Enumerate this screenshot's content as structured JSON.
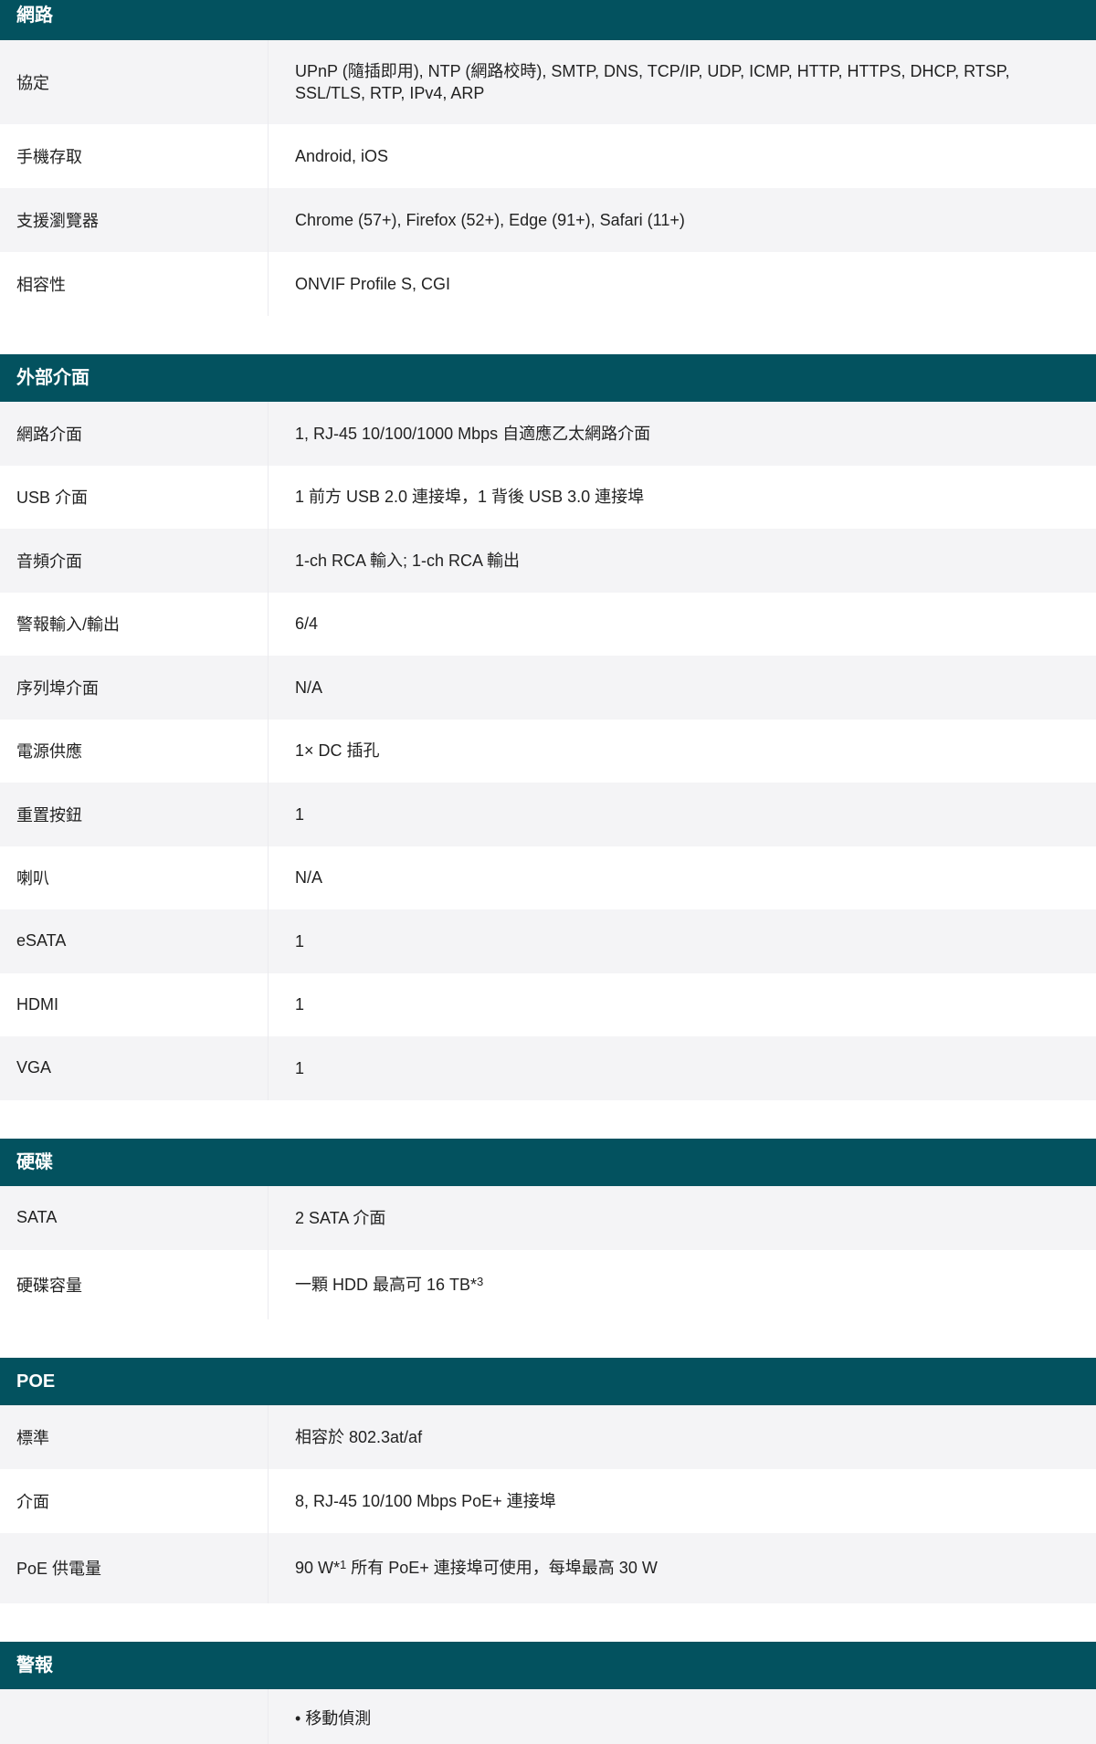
{
  "sections": {
    "network": {
      "title": "網路",
      "rows": [
        {
          "label": "協定",
          "value": "UPnP (隨插即用), NTP (網路校時), SMTP, DNS, TCP/IP, UDP, ICMP, HTTP, HTTPS, DHCP, RTSP, SSL/TLS, RTP, IPv4, ARP"
        },
        {
          "label": "手機存取",
          "value": "Android, iOS"
        },
        {
          "label": "支援瀏覽器",
          "value": "Chrome (57+), Firefox (52+), Edge (91+), Safari (11+)"
        },
        {
          "label": "相容性",
          "value": "ONVIF Profile S, CGI"
        }
      ]
    },
    "external": {
      "title": "外部介面",
      "rows": [
        {
          "label": "網路介面",
          "value": "1, RJ-45 10/100/1000 Mbps 自適應乙太網路介面"
        },
        {
          "label": "USB 介面",
          "value": "1 前方 USB 2.0 連接埠，1 背後 USB 3.0 連接埠"
        },
        {
          "label": "音頻介面",
          "value": "1-ch RCA 輸入; 1-ch RCA 輸出"
        },
        {
          "label": "警報輸入/輸出",
          "value": "6/4"
        },
        {
          "label": "序列埠介面",
          "value": "N/A"
        },
        {
          "label": "電源供應",
          "value": "1× DC 插孔"
        },
        {
          "label": "重置按鈕",
          "value": "1"
        },
        {
          "label": "喇叭",
          "value": "N/A"
        },
        {
          "label": "eSATA",
          "value": "1"
        },
        {
          "label": "HDMI",
          "value": "1"
        },
        {
          "label": "VGA",
          "value": "1"
        }
      ]
    },
    "hdd": {
      "title": "硬碟",
      "rows": [
        {
          "label": "SATA",
          "value": "2 SATA 介面"
        },
        {
          "label": "硬碟容量",
          "value": "一顆 HDD 最高可 16 TB*",
          "sup": "3"
        }
      ]
    },
    "poe": {
      "title": "POE",
      "rows": [
        {
          "label": "標準",
          "value": "相容於 802.3at/af"
        },
        {
          "label": "介面",
          "value": "8, RJ-45 10/100 Mbps PoE+ 連接埠"
        },
        {
          "label": "PoE 供電量",
          "value_pre": "90 W*",
          "sup": "1",
          "value_post": " 所有 PoE+ 連接埠可使用，每埠最高 30 W"
        }
      ]
    },
    "alarm": {
      "title": "警報",
      "first_item": "移動偵測"
    }
  }
}
